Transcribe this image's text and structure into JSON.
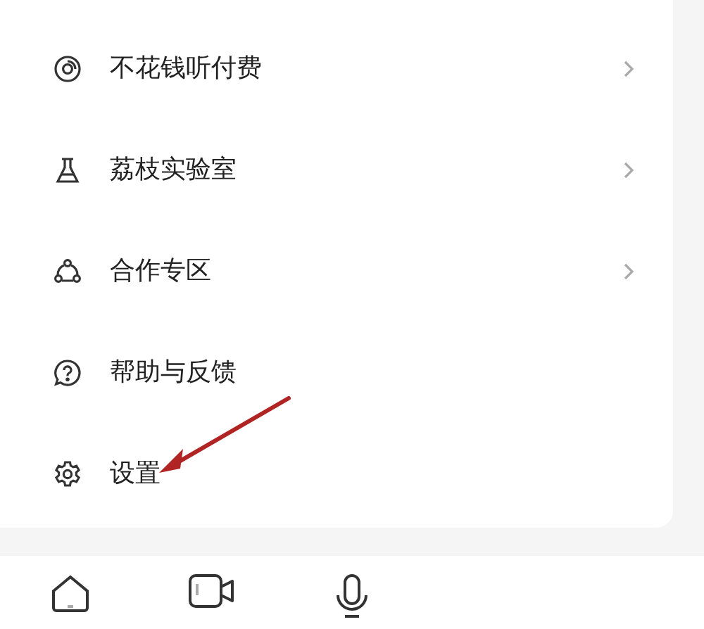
{
  "menu": [
    {
      "label": "不花钱听付费",
      "chevron": true
    },
    {
      "label": "荔枝实验室",
      "chevron": true
    },
    {
      "label": "合作专区",
      "chevron": true
    },
    {
      "label": "帮助与反馈",
      "chevron": false
    },
    {
      "label": "设置",
      "chevron": false
    }
  ],
  "annotation": {
    "kind": "arrow"
  }
}
